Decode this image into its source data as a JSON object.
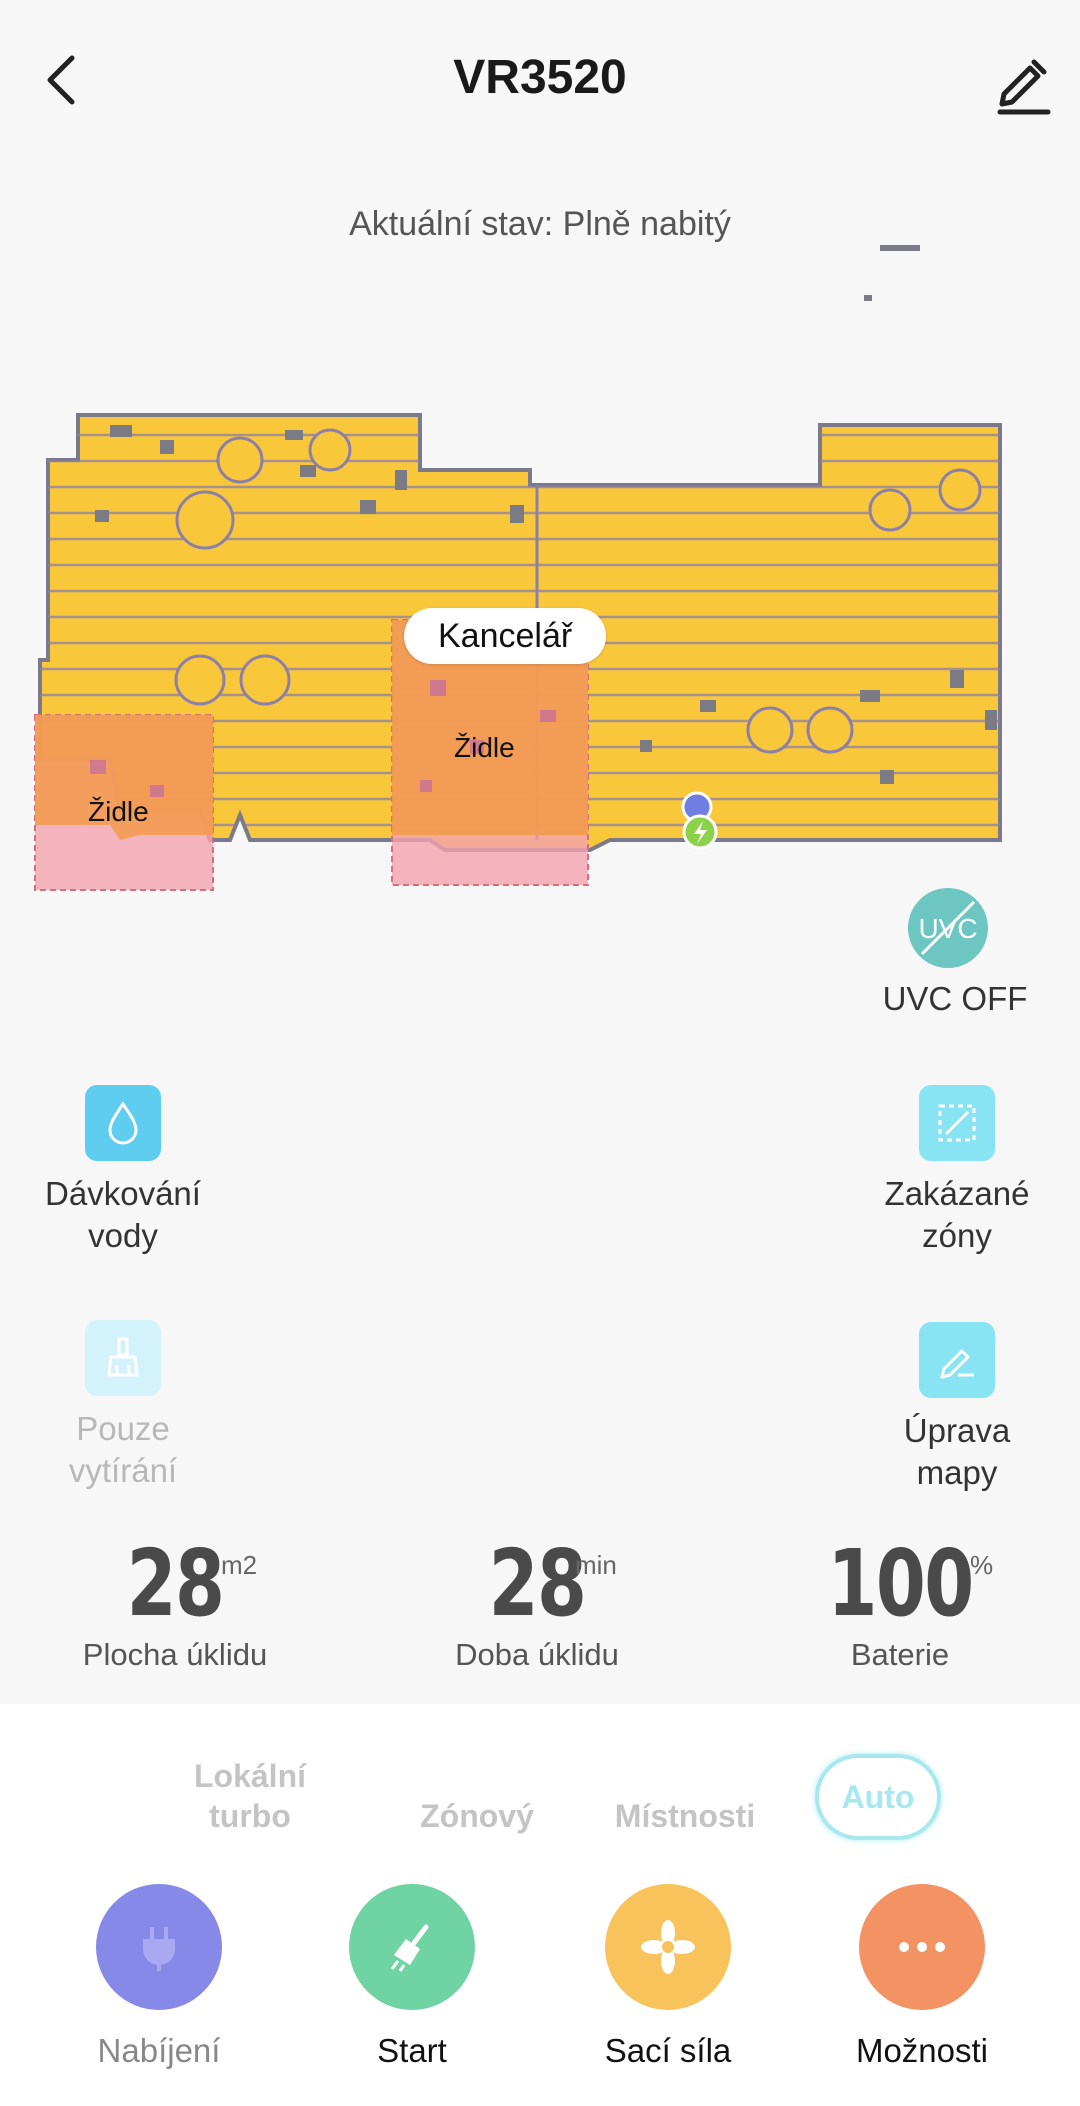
{
  "header": {
    "title": "VR3520",
    "back_icon": "chevron-left-icon",
    "edit_icon": "pencil-icon"
  },
  "status": "Aktuální stav: Plně nabitý",
  "map": {
    "room_label": "Kancelář",
    "zones": [
      {
        "label": "Židle"
      },
      {
        "label": "Židle"
      }
    ],
    "colors": {
      "floor": "#f9c83a",
      "outline": "#7a7a8a",
      "forbidden_zone": "#f2a3ae",
      "zone_overlap": "#f39a4e"
    }
  },
  "uvc": {
    "label": "UVC OFF",
    "icon_text": "UVC",
    "color": "#6ec6c3"
  },
  "tools": {
    "water": {
      "label": "Dávkování\nvody",
      "icon": "water-drop-icon"
    },
    "mop_only": {
      "label": "Pouze\nvytírání",
      "icon": "mop-icon",
      "disabled": true
    },
    "forbidden": {
      "label": "Zakázané\nzóny",
      "icon": "forbidden-zone-icon"
    },
    "map_edit": {
      "label": "Úprava\nmapy",
      "icon": "edit-map-icon"
    }
  },
  "stats": {
    "area": {
      "value": "28",
      "unit": "m2",
      "label": "Plocha úklidu"
    },
    "time": {
      "value": "28",
      "unit": "min",
      "label": "Doba úklidu"
    },
    "battery": {
      "value": "100",
      "unit": "%",
      "label": "Baterie"
    }
  },
  "modes": {
    "local_turbo": "Lokální\nturbo",
    "zone": "Zónový",
    "rooms": "Místnosti",
    "auto": "Auto",
    "selected": "Auto"
  },
  "actions": {
    "charge": {
      "label": "Nabíjení",
      "icon": "plug-icon",
      "color": "#8789e8"
    },
    "start": {
      "label": "Start",
      "icon": "broom-icon",
      "color": "#6fd3a3"
    },
    "suction": {
      "label": "Sací síla",
      "icon": "fan-icon",
      "color": "#f7c35a"
    },
    "options": {
      "label": "Možnosti",
      "icon": "more-dots-icon",
      "color": "#f39263"
    }
  }
}
